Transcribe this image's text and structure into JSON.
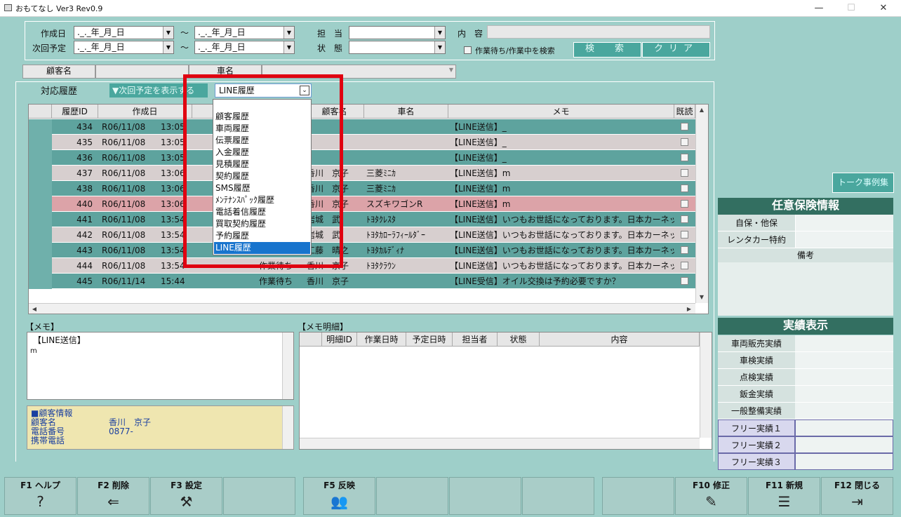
{
  "window": {
    "title": "おもてなし Ver3 Rev0.9",
    "min": "—",
    "max": "☐",
    "close": "✕"
  },
  "search": {
    "created_label": "作成日",
    "next_label": "次回予定",
    "tilde": "〜",
    "date_placeholder": "._._年_月_日",
    "staff_label": "担　当",
    "state_label": "状　態",
    "content_label": "内　容",
    "waiting_checkbox_label": "作業待ち/作業中を検索",
    "search_button": "検　索",
    "clear_button": "クリア"
  },
  "customer_bar": {
    "customer_label": "顧客名",
    "car_label": "車名"
  },
  "history": {
    "section_label": "対応履歴",
    "toggle_button": "▼次回予定を表示する",
    "type_selected": "LINE履歴",
    "dropdown_options": [
      "顧客履歴",
      "車両履歴",
      "伝票履歴",
      "入金履歴",
      "見積履歴",
      "契約履歴",
      "SMS履歴",
      "ﾒﾝﾃﾅﾝｽﾊﾟｯｸ履歴",
      "電話着信履歴",
      "買取契約履歴",
      "予約履歴",
      "LINE履歴"
    ],
    "columns": [
      "履歴ID",
      "作成日",
      "",
      "",
      "顧客名",
      "車名",
      "メモ",
      "既読"
    ],
    "rows": [
      {
        "id": "434",
        "date": "R06/11/08",
        "time": "13:05",
        "status": "",
        "customer": "",
        "car": "",
        "memo": "【LINE送信】_",
        "tone": "dark"
      },
      {
        "id": "435",
        "date": "R06/11/08",
        "time": "13:05",
        "status": "",
        "customer": "",
        "car": "",
        "memo": "【LINE送信】_",
        "tone": "light"
      },
      {
        "id": "436",
        "date": "R06/11/08",
        "time": "13:05",
        "status": "",
        "customer": "",
        "car": "",
        "memo": "【LINE送信】_",
        "tone": "dark"
      },
      {
        "id": "437",
        "date": "R06/11/08",
        "time": "13:06",
        "status": "",
        "customer": "香川　京子",
        "car": "三菱ﾐﾆｶ",
        "memo": "【LINE送信】m",
        "tone": "light"
      },
      {
        "id": "438",
        "date": "R06/11/08",
        "time": "13:06",
        "status": "",
        "customer": "香川　京子",
        "car": "三菱ﾐﾆｶ",
        "memo": "【LINE送信】m",
        "tone": "dark"
      },
      {
        "id": "440",
        "date": "R06/11/08",
        "time": "13:06",
        "status": "",
        "customer": "香川　京子",
        "car": "スズキワゴンR",
        "memo": "【LINE送信】m",
        "tone": "pink"
      },
      {
        "id": "441",
        "date": "R06/11/08",
        "time": "13:54",
        "status": "",
        "customer": "岩城　武",
        "car": "ﾄﾖﾀｸﾚｽﾀ",
        "memo": "【LINE送信】いつもお世話になっております。日本カーネッ",
        "tone": "dark"
      },
      {
        "id": "442",
        "date": "R06/11/08",
        "time": "13:54",
        "status": "",
        "customer": "岩城　武",
        "car": "ﾄﾖﾀｶﾛｰﾗﾌｨｰﾙﾀﾞｰ",
        "memo": "【LINE送信】いつもお世話になっております。日本カーネッ",
        "tone": "light"
      },
      {
        "id": "443",
        "date": "R06/11/08",
        "time": "13:54",
        "status": "",
        "customer": "工藤　晴之",
        "car": "ﾄﾖﾀｶﾙﾃﾞｨﾅ",
        "memo": "【LINE送信】いつもお世話になっております。日本カーネッ",
        "tone": "dark"
      },
      {
        "id": "444",
        "date": "R06/11/08",
        "time": "13:54",
        "status": "作業待ち",
        "customer": "香川　京子",
        "car": "ﾄﾖﾀｸﾗｳﾝ",
        "memo": "【LINE送信】いつもお世話になっております。日本カーネッ",
        "tone": "light"
      },
      {
        "id": "445",
        "date": "R06/11/14",
        "time": "15:44",
        "status": "作業待ち",
        "customer": "香川　京子",
        "car": "",
        "memo": "【LINE受信】オイル交換は予約必要ですか？",
        "tone": "dark"
      }
    ]
  },
  "memo": {
    "label": "【メモ】",
    "text_line1": "【LINE送信】",
    "text_line2": "m"
  },
  "customer_info": {
    "heading": "■顧客情報",
    "name_label": "顧客名",
    "name_value": "香川　京子",
    "phone_label": "電話番号",
    "phone_value": "0877-",
    "mobile_label": "携帯電話"
  },
  "memo_detail": {
    "label": "【メモ明細】",
    "columns": [
      "明細ID",
      "作業日時",
      "予定日時",
      "担当者",
      "状態",
      "内容"
    ]
  },
  "right_panel": {
    "talk_button": "トーク事例集",
    "insurance_title": "任意保険情報",
    "insurance_rows": [
      "自保・他保",
      "レンタカー特約"
    ],
    "remarks_label": "備考",
    "results_title": "実績表示",
    "results_rows": [
      "車両販売実績",
      "車検実績",
      "点検実績",
      "鈑金実績",
      "一般整備実績"
    ],
    "free_rows": [
      "フリー実績１",
      "フリー実績２",
      "フリー実績３"
    ]
  },
  "fkeys": [
    {
      "label": "F1 ヘルプ",
      "icon": "?"
    },
    {
      "label": "F2 削除",
      "icon": "⇐"
    },
    {
      "label": "F3 設定",
      "icon": "⚒"
    },
    {
      "label": "F5 反映",
      "icon": "👥"
    },
    {
      "label": "F10 修正",
      "icon": "✎"
    },
    {
      "label": "F11 新規",
      "icon": "☰"
    },
    {
      "label": "F12 閉じる",
      "icon": "⇥"
    }
  ],
  "colors": {
    "bg": "#9ecfc9",
    "row_dark": "#5ea39e",
    "row_light": "#d7cfcf",
    "row_pink": "#dca3a8",
    "header_dark": "#336f61",
    "highlight": "#e00010",
    "accent": "#4aa79e"
  }
}
